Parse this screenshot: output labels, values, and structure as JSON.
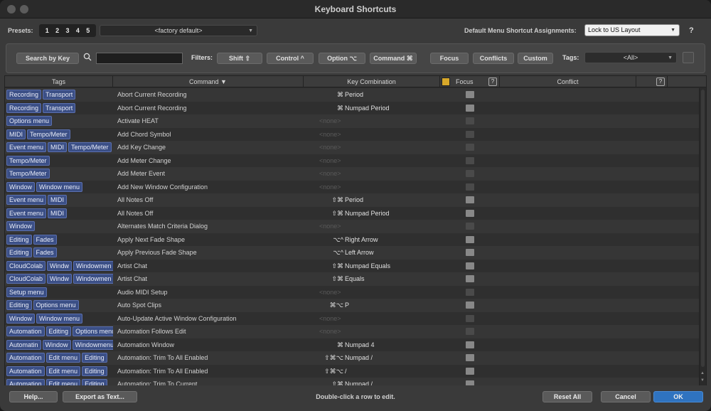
{
  "window": {
    "title": "Keyboard Shortcuts"
  },
  "presets": {
    "label": "Presets:",
    "numbers": [
      "1",
      "2",
      "3",
      "4",
      "5"
    ],
    "selected": "<factory default>",
    "menu_assign_label": "Default Menu Shortcut Assignments:",
    "menu_assign_value": "Lock to US Layout",
    "help": "?"
  },
  "filterbar": {
    "search_by_key": "Search by Key",
    "search_value": "",
    "filters_label": "Filters:",
    "shift": "Shift ⇧",
    "control": "Control ^",
    "option": "Option ⌥",
    "command": "Command ⌘",
    "focus": "Focus",
    "conflicts": "Conflicts",
    "custom": "Custom",
    "tags_label": "Tags:",
    "tags_value": "<All>"
  },
  "table": {
    "headers": {
      "tags": "Tags",
      "command": "Command ▼",
      "key": "Key Combination",
      "focus": "Focus",
      "conflict": "Conflict",
      "q": "?"
    },
    "none_text": "<none>",
    "rows": [
      {
        "tags": [
          "Recording",
          "Transport"
        ],
        "command": "Abort Current Recording",
        "mods": "⌘",
        "key": "Period",
        "focus": true
      },
      {
        "tags": [
          "Recording",
          "Transport"
        ],
        "command": "Abort Current Recording",
        "mods": "⌘",
        "key": "Numpad Period",
        "focus": true
      },
      {
        "tags": [
          "Options menu"
        ],
        "command": "Activate HEAT",
        "mods": "",
        "key": "",
        "focus": false
      },
      {
        "tags": [
          "MIDI",
          "Tempo/Meter"
        ],
        "command": "Add Chord Symbol",
        "mods": "",
        "key": "",
        "focus": false
      },
      {
        "tags": [
          "Event menu",
          "MIDI",
          "Tempo/Meter"
        ],
        "command": "Add Key Change",
        "mods": "",
        "key": "",
        "focus": false
      },
      {
        "tags": [
          "Tempo/Meter"
        ],
        "command": "Add Meter Change",
        "mods": "",
        "key": "",
        "focus": false
      },
      {
        "tags": [
          "Tempo/Meter"
        ],
        "command": "Add Meter Event",
        "mods": "",
        "key": "",
        "focus": false
      },
      {
        "tags": [
          "Window",
          "Window menu"
        ],
        "command": "Add New Window Configuration",
        "mods": "",
        "key": "",
        "focus": false
      },
      {
        "tags": [
          "Event menu",
          "MIDI"
        ],
        "command": "All Notes Off",
        "mods": "⇧⌘",
        "key": "Period",
        "focus": true
      },
      {
        "tags": [
          "Event menu",
          "MIDI"
        ],
        "command": "All Notes Off",
        "mods": "⇧⌘",
        "key": "Numpad Period",
        "focus": true
      },
      {
        "tags": [
          "Window"
        ],
        "command": "Alternates Match Criteria Dialog",
        "mods": "",
        "key": "",
        "focus": false
      },
      {
        "tags": [
          "Editing",
          "Fades"
        ],
        "command": "Apply Next Fade Shape",
        "mods": "⌥^",
        "key": "Right Arrow",
        "focus": true
      },
      {
        "tags": [
          "Editing",
          "Fades"
        ],
        "command": "Apply Previous Fade Shape",
        "mods": "⌥^",
        "key": "Left Arrow",
        "focus": true
      },
      {
        "tags": [
          "CloudColab",
          "Windw",
          "Windowmen"
        ],
        "command": "Artist Chat",
        "mods": "⇧⌘",
        "key": "Numpad Equals",
        "focus": true
      },
      {
        "tags": [
          "CloudColab",
          "Windw",
          "Windowmen"
        ],
        "command": "Artist Chat",
        "mods": "⇧⌘",
        "key": "Equals",
        "focus": true
      },
      {
        "tags": [
          "Setup menu"
        ],
        "command": "Audio MIDI Setup",
        "mods": "",
        "key": "",
        "focus": false
      },
      {
        "tags": [
          "Editing",
          "Options menu"
        ],
        "command": "Auto Spot Clips",
        "mods": "⌘⌥",
        "key": "P",
        "focus": true
      },
      {
        "tags": [
          "Window",
          "Window menu"
        ],
        "command": "Auto-Update Active Window Configuration",
        "mods": "",
        "key": "",
        "focus": false
      },
      {
        "tags": [
          "Automation",
          "Editing",
          "Options menu"
        ],
        "command": "Automation Follows Edit",
        "mods": "",
        "key": "",
        "focus": false
      },
      {
        "tags": [
          "Automatin",
          "Window",
          "Windowmenu"
        ],
        "command": "Automation Window",
        "mods": "⌘",
        "key": "Numpad 4",
        "focus": true
      },
      {
        "tags": [
          "Automation",
          "Edit menu",
          "Editing"
        ],
        "command": "Automation: Trim To All Enabled",
        "mods": "⇧⌘⌥",
        "key": "Numpad /",
        "focus": true
      },
      {
        "tags": [
          "Automation",
          "Edit menu",
          "Editing"
        ],
        "command": "Automation: Trim To All Enabled",
        "mods": "⇧⌘⌥",
        "key": "/",
        "focus": true
      },
      {
        "tags": [
          "Automation",
          "Edit menu",
          "Editing"
        ],
        "command": "Automation: Trim To Current",
        "mods": "⇧⌘",
        "key": "Numpad /",
        "focus": true
      }
    ]
  },
  "bottom": {
    "help": "Help...",
    "export": "Export as Text...",
    "hint": "Double-click a row to edit.",
    "reset": "Reset All",
    "cancel": "Cancel",
    "ok": "OK"
  }
}
